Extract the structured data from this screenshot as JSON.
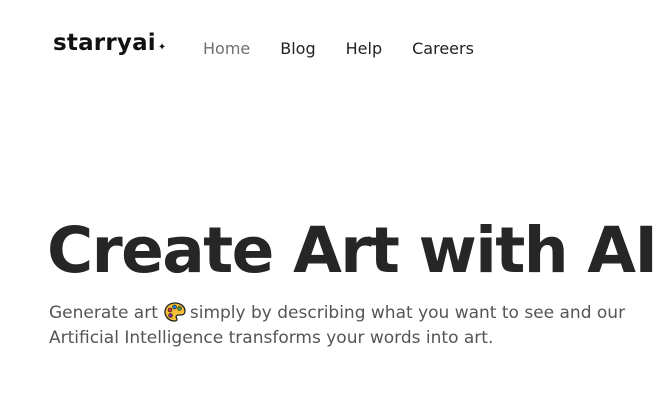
{
  "header": {
    "logo_text": "starryai",
    "logo_mark": "✦",
    "nav": [
      {
        "label": "Home"
      },
      {
        "label": "Blog"
      },
      {
        "label": "Help"
      },
      {
        "label": "Careers"
      }
    ]
  },
  "hero": {
    "title": "Create Art with AI",
    "subtitle_before_icon": "Generate art",
    "subtitle_icon": "artist-palette-icon",
    "subtitle_after_icon": "simply by describing what you want to see and our Artificial Intelligence transforms your words into art."
  },
  "colors": {
    "background": "#ffffff",
    "text_primary": "#262626",
    "text_secondary": "#555555",
    "nav_active": "#6f6f6f",
    "palette_yellow": "#f5c03a"
  }
}
